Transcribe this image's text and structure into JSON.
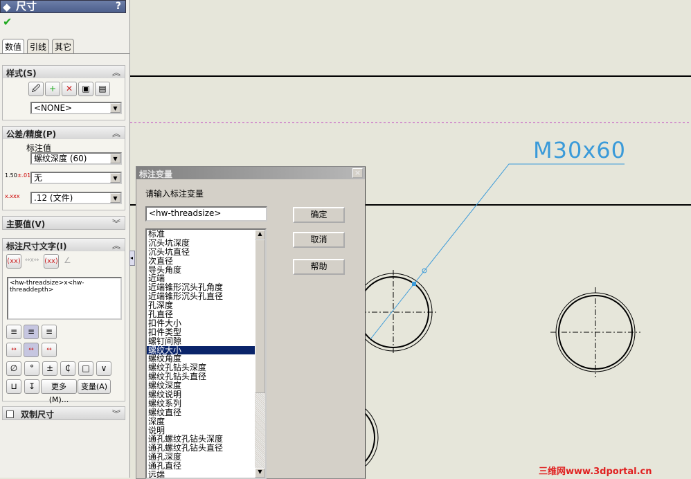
{
  "panel": {
    "title": "尺寸",
    "help": "?",
    "ok_icon": "checkmark-icon",
    "tabs": [
      "数值",
      "引线",
      "其它"
    ],
    "style_section": {
      "title": "样式(S)",
      "style_value": "<NONE>"
    },
    "tolerance_section": {
      "title": "公差/精度(P)",
      "label": "标注值",
      "value_combo": "螺纹深度 (60)",
      "tolerance_combo": "无",
      "precision_combo": ".12 (文件)",
      "tol_icon_text": "1.50"
    },
    "primary_section": {
      "title": "主要值(V)"
    },
    "text_section": {
      "title": "标注尺寸文字(I)",
      "text": "<hw-threadsize>x<hw-threaddepth>",
      "more_label": "更多(M)...",
      "variable_label": "变量(A)"
    },
    "dual_section": {
      "title": "双制尺寸"
    }
  },
  "dialog": {
    "title": "标注变量",
    "close": "×",
    "prompt": "请输入标注变量",
    "input_value": "<hw-threadsize>",
    "ok": "确定",
    "cancel": "取消",
    "help": "帮助",
    "items": [
      "标准",
      "沉头坑深度",
      "沉头坑直径",
      "次直径",
      "导头角度",
      "近端",
      "近端锥形沉头孔角度",
      "近端锥形沉头孔直径",
      "孔深度",
      "孔直径",
      "扣件大小",
      "扣件类型",
      "螺钉间隙",
      "螺纹大小",
      "螺纹角度",
      "螺纹孔钻头深度",
      "螺纹孔钻头直径",
      "螺纹深度",
      "螺纹说明",
      "螺纹系列",
      "螺纹直径",
      "深度",
      "说明",
      "通孔螺纹孔钻头深度",
      "通孔螺纹孔钻头直径",
      "通孔深度",
      "通孔直径",
      "远端"
    ],
    "selected_index": 13
  },
  "drawing": {
    "dimension_text": "M30x60",
    "accent": "#3a9ad9"
  },
  "watermark": "三维网www.3dportal.cn"
}
